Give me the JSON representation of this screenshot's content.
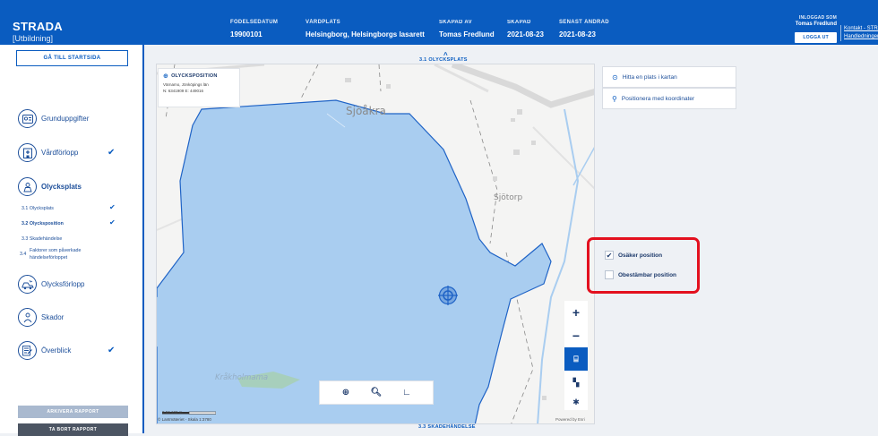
{
  "header": {
    "app_title": "STRADA",
    "app_sub": "[Utbildning]",
    "columns": [
      {
        "label": "FÖDELSEDATUM",
        "value": "19900101"
      },
      {
        "label": "VÅRDPLATS",
        "value": "Helsingborg, Helsingborgs lasarett"
      },
      {
        "label": "SKAPAD AV",
        "value": "Tomas Fredlund"
      },
      {
        "label": "SKAPAD",
        "value": "2021-08-23"
      },
      {
        "label": "SENAST ÄNDRAD",
        "value": "2021-08-23"
      }
    ],
    "user_label": "INLOGGAD SOM",
    "user_name": "Tomas Fredlund",
    "logout_label": "LOGGA UT",
    "links": [
      "Kontakt - STRADA",
      "Handledningen"
    ]
  },
  "sidebar": {
    "home_button": "GÅ TILL STARTSIDA",
    "items": [
      {
        "label": "Grunduppgifter",
        "checked": false,
        "icon": "id-card-icon"
      },
      {
        "label": "Vårdförlopp",
        "checked": true,
        "icon": "hospital-icon"
      },
      {
        "label": "Olycksplats",
        "checked": false,
        "icon": "map-person-icon"
      },
      {
        "label": "Olycksförlopp",
        "checked": false,
        "icon": "crash-icon"
      },
      {
        "label": "Skador",
        "checked": false,
        "icon": "injury-icon"
      },
      {
        "label": "Överblick",
        "checked": true,
        "icon": "overview-icon"
      }
    ],
    "subitems": [
      {
        "label": "3.1 Olycksplats",
        "checked": true
      },
      {
        "label": "3.2 Olycksposition",
        "checked": true
      },
      {
        "label": "3.3 Skadehändelse",
        "checked": false
      },
      {
        "label_num": "3.4",
        "label_line1": "Faktorer som påverkade",
        "label_line2": "händelseförloppet",
        "checked": false
      }
    ],
    "archive_button": "ARKIVERA RAPPORT",
    "delete_button": "TA BORT RAPPORT"
  },
  "main": {
    "prev_section": "3.1 OLYCKSPLATS",
    "next_section": "3.3 SKADEHÄNDELSE",
    "position_card": {
      "title": "OLYCKSPOSITION",
      "location": "Värnamo, Jönköpings län",
      "coords": "N: 6341909   E: 449016"
    },
    "map_labels": {
      "place1": "Sjöåkra",
      "place2": "Sjötorp",
      "place3": "Kråkholmama"
    },
    "map_controls": {
      "zoom_in": "+",
      "zoom_out": "−"
    },
    "scale_labels": "0      50      100 m",
    "attribution": "© Lantmäteriet - Skala 1:3780",
    "powered_by": "Powered by Esri",
    "right_buttons": [
      {
        "label": "Hitta en plats i kartan",
        "icon": "search-location-icon"
      },
      {
        "label": "Positionera med koordinater",
        "icon": "pin-icon"
      }
    ],
    "checkboxes": [
      {
        "label": "Osäker position",
        "checked": true
      },
      {
        "label": "Obestämbar position",
        "checked": false
      }
    ],
    "colors": {
      "brand": "#0a5cc0",
      "highlight": "#e3101e",
      "water": "#a9cdf0"
    }
  }
}
